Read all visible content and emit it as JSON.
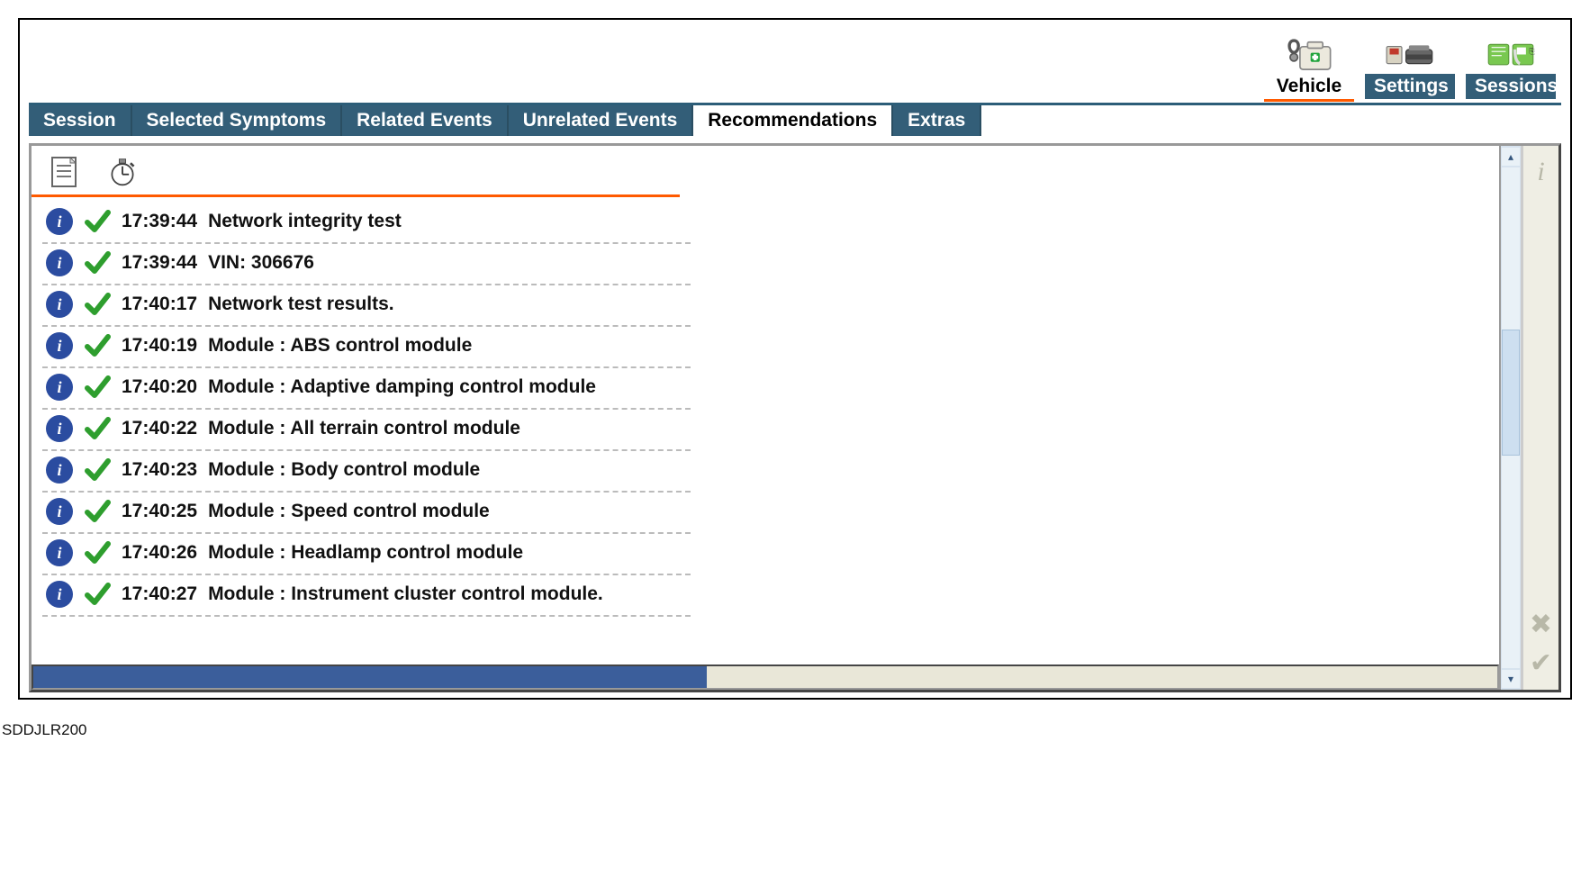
{
  "caption": "SDDJLR200",
  "toolbar": {
    "vehicle": "Vehicle",
    "settings": "Settings",
    "sessions": "Sessions"
  },
  "tabs": {
    "session": "Session",
    "selected_symptoms": "Selected Symptoms",
    "related_events": "Related Events",
    "unrelated_events": "Unrelated Events",
    "recommendations": "Recommendations",
    "extras": "Extras",
    "active": "recommendations"
  },
  "log": {
    "rows": [
      {
        "time": "17:39:44",
        "desc": "Network integrity test"
      },
      {
        "time": "17:39:44",
        "desc": "VIN: 306676"
      },
      {
        "time": "17:40:17",
        "desc": "Network test results."
      },
      {
        "time": "17:40:19",
        "desc": "Module : ABS control module"
      },
      {
        "time": "17:40:20",
        "desc": "Module : Adaptive damping control module"
      },
      {
        "time": "17:40:22",
        "desc": "Module : All terrain control module"
      },
      {
        "time": "17:40:23",
        "desc": "Module : Body control module"
      },
      {
        "time": "17:40:25",
        "desc": "Module : Speed control module"
      },
      {
        "time": "17:40:26",
        "desc": "Module : Headlamp control module"
      },
      {
        "time": "17:40:27",
        "desc": "Module : Instrument cluster control module."
      }
    ]
  },
  "progress_percent": 46
}
